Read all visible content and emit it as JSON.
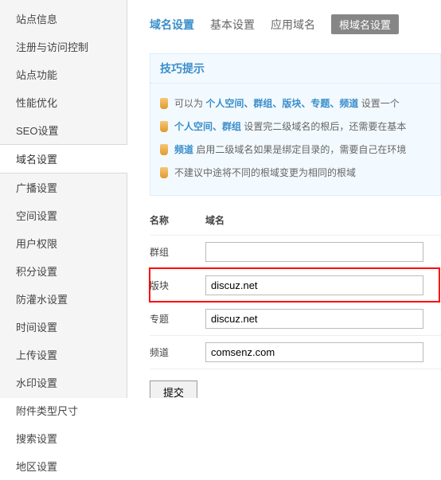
{
  "sidebar": {
    "items": [
      {
        "label": "站点信息"
      },
      {
        "label": "注册与访问控制"
      },
      {
        "label": "站点功能"
      },
      {
        "label": "性能优化"
      },
      {
        "label": "SEO设置"
      },
      {
        "label": "域名设置"
      },
      {
        "label": "广播设置"
      },
      {
        "label": "空间设置"
      },
      {
        "label": "用户权限"
      },
      {
        "label": "积分设置"
      },
      {
        "label": "防灌水设置"
      },
      {
        "label": "时间设置"
      },
      {
        "label": "上传设置"
      },
      {
        "label": "水印设置"
      },
      {
        "label": "附件类型尺寸"
      },
      {
        "label": "搜索设置"
      },
      {
        "label": "地区设置"
      }
    ],
    "active_index": 5
  },
  "tabs": {
    "items": [
      {
        "label": "域名设置",
        "style": "active"
      },
      {
        "label": "基本设置",
        "style": "normal"
      },
      {
        "label": "应用域名",
        "style": "normal"
      },
      {
        "label": "根域名设置",
        "style": "pill"
      }
    ]
  },
  "tips": {
    "header": "技巧提示",
    "lines": [
      {
        "pre": "可以为 ",
        "hl": "个人空间、群组、版块、专题、频道 ",
        "post": "设置一个"
      },
      {
        "pre": "",
        "hl": "个人空间、群组 ",
        "post": "设置完二级域名的根后，还需要在基本"
      },
      {
        "pre": "",
        "hl": "频道 ",
        "post": "启用二级域名如果是绑定目录的，需要自己在环境"
      },
      {
        "pre": "不建议中途将不同的根域变更为相同的根域",
        "hl": "",
        "post": ""
      }
    ]
  },
  "form": {
    "header_name": "名称",
    "header_domain": "域名",
    "rows": [
      {
        "label": "群组",
        "value": ""
      },
      {
        "label": "版块",
        "value": "discuz.net"
      },
      {
        "label": "专题",
        "value": "discuz.net"
      },
      {
        "label": "频道",
        "value": "comsenz.com"
      }
    ],
    "highlight_index": 1,
    "submit": "提交"
  }
}
